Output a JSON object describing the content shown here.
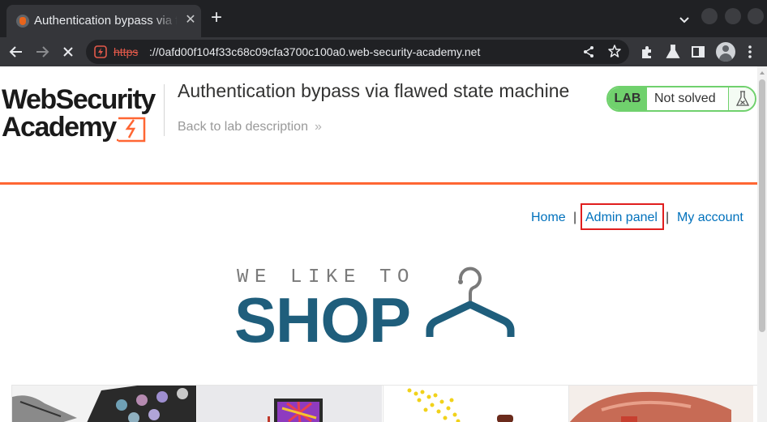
{
  "browser": {
    "tab_title": "Authentication bypass via flawed state machine",
    "tab_close": "✕",
    "new_tab": "+",
    "url_scheme": "https",
    "url_rest": "://0afd00f104f33c68c09cfa3700c100a0.web-security-academy.net"
  },
  "header": {
    "logo_line1": "WebSecurity",
    "logo_line2": "Academy",
    "lab_title": "Authentication bypass via flawed state machine",
    "back_link": "Back to lab description",
    "back_chevron": "»",
    "badge_label": "LAB",
    "badge_status": "Not solved"
  },
  "nav": {
    "home": "Home",
    "separator": "|",
    "admin_panel": "Admin panel",
    "my_account": "My account"
  },
  "hero": {
    "tagline": "WE LIKE TO",
    "title": "SHOP"
  },
  "colors": {
    "brand_orange": "#ff6633",
    "lab_green": "#70d16d",
    "link_blue": "#0071bc",
    "shop_blue": "#1f5e7c",
    "highlight_red": "#e01e1e"
  }
}
